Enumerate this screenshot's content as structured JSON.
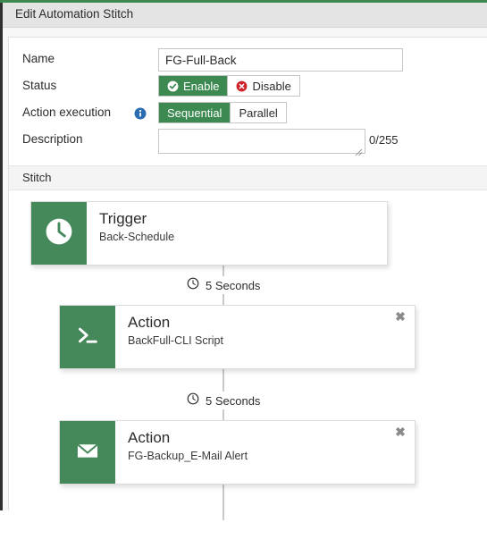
{
  "window": {
    "title": "Edit Automation Stitch",
    "accent_color": "#3c8a51"
  },
  "form": {
    "name": {
      "label": "Name",
      "value": "FG-Full-Back",
      "placeholder": ""
    },
    "status": {
      "label": "Status",
      "selected": "Enable",
      "options": [
        {
          "label": "Enable",
          "icon": "check-circle-icon",
          "active": true
        },
        {
          "label": "Disable",
          "icon": "x-circle-icon",
          "active": false
        }
      ]
    },
    "action_execution": {
      "label": "Action execution",
      "info_icon": "info-icon",
      "selected": "Sequential",
      "options": [
        {
          "label": "Sequential",
          "active": true
        },
        {
          "label": "Parallel",
          "active": false
        }
      ]
    },
    "description": {
      "label": "Description",
      "value": "",
      "placeholder": "",
      "counter": "0/255"
    }
  },
  "stitch": {
    "section_title": "Stitch",
    "nodes": [
      {
        "type": "trigger",
        "icon": "clock-icon",
        "title": "Trigger",
        "subtitle": "Back-Schedule",
        "closable": false
      },
      {
        "type": "action",
        "icon": "terminal-icon",
        "title": "Action",
        "subtitle": "BackFull-CLI Script",
        "closable": true,
        "close_label": "✖"
      },
      {
        "type": "action",
        "icon": "envelope-icon",
        "title": "Action",
        "subtitle": "FG-Backup_E-Mail Alert",
        "closable": true,
        "close_label": "✖"
      }
    ],
    "delays": [
      {
        "icon": "clock-outline-icon",
        "label": "5 Seconds"
      },
      {
        "icon": "clock-outline-icon",
        "label": "5 Seconds"
      }
    ]
  }
}
